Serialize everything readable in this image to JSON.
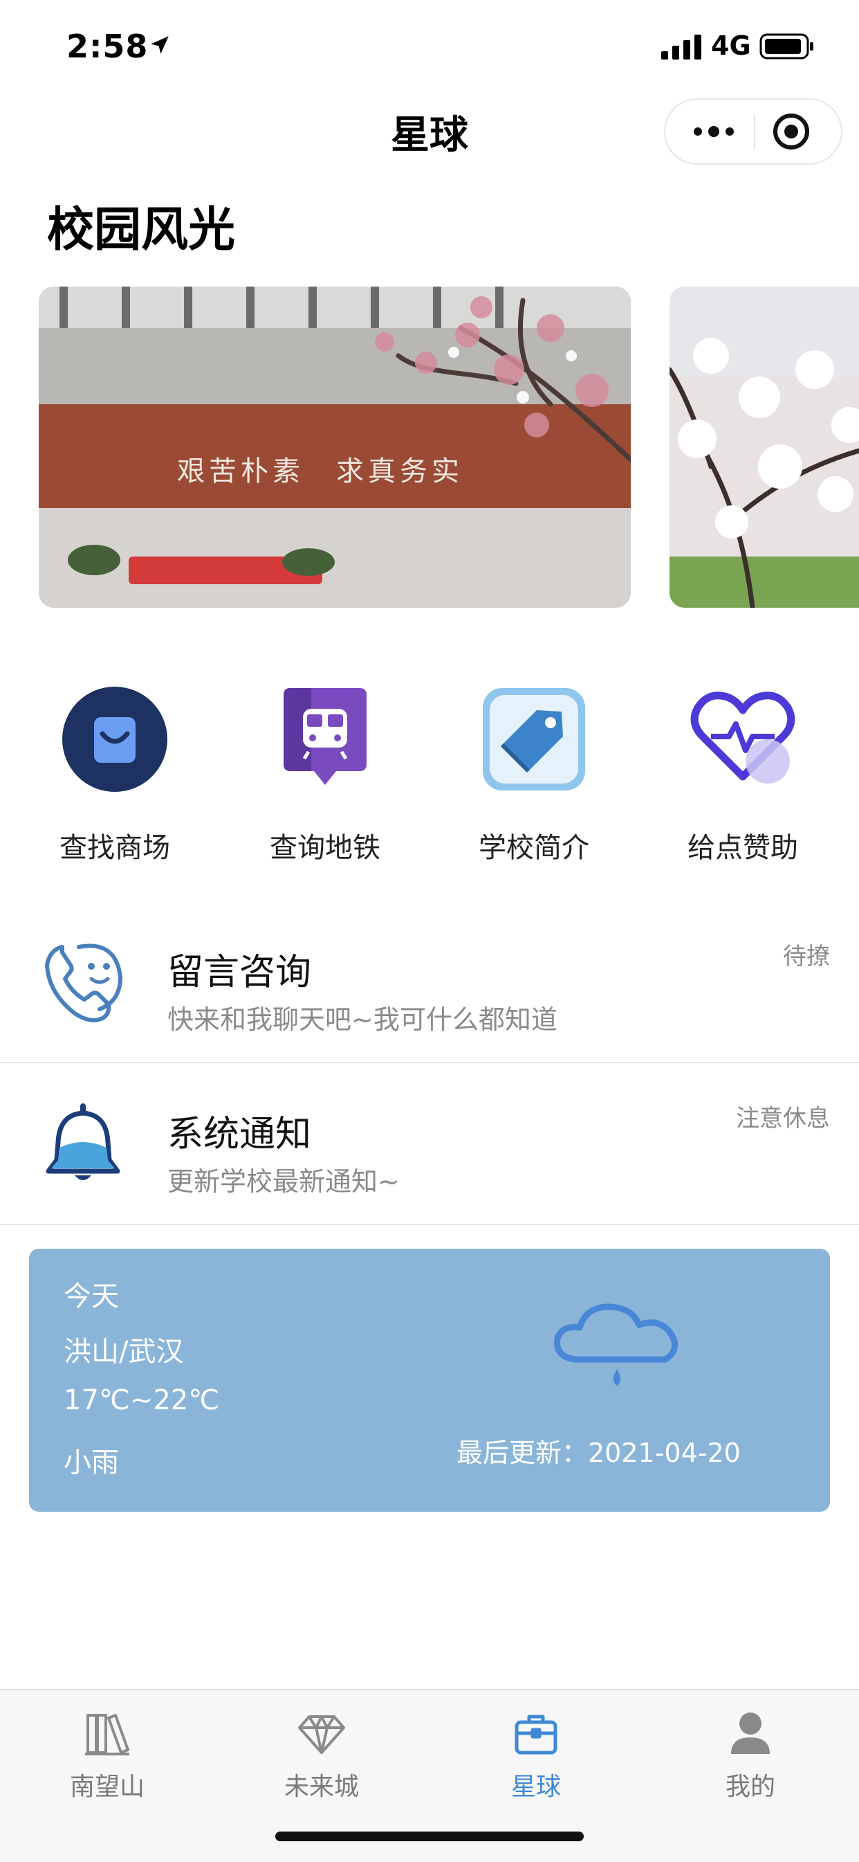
{
  "status_bar": {
    "time": "2:58",
    "network": "4G"
  },
  "header": {
    "title": "星球"
  },
  "section": {
    "title": "校园风光"
  },
  "banner": {
    "slogan": "艰苦朴素　求真务实"
  },
  "grid": [
    {
      "label": "查找商场",
      "icon": "shopping-bag-icon"
    },
    {
      "label": "查询地铁",
      "icon": "subway-icon"
    },
    {
      "label": "学校简介",
      "icon": "tag-icon"
    },
    {
      "label": "给点赞助",
      "icon": "heart-pulse-icon"
    }
  ],
  "messages": [
    {
      "title": "留言咨询",
      "subtitle": "快来和我聊天吧~我可什么都知道",
      "meta": "待撩",
      "icon": "phone-smile-icon"
    },
    {
      "title": "系统通知",
      "subtitle": "更新学校最新通知~",
      "meta": "注意休息",
      "icon": "bell-icon"
    }
  ],
  "weather": {
    "day": "今天",
    "location": "洪山/武汉",
    "temperature": "17℃~22℃",
    "condition": "小雨",
    "updated": "最后更新：2021-04-20"
  },
  "tabbar": [
    {
      "label": "南望山",
      "icon": "books-icon",
      "active": false
    },
    {
      "label": "未来城",
      "icon": "diamond-icon",
      "active": false
    },
    {
      "label": "星球",
      "icon": "briefcase-icon",
      "active": true
    },
    {
      "label": "我的",
      "icon": "user-icon",
      "active": false
    }
  ],
  "colors": {
    "accent": "#3f88d6",
    "weather_card": "#8ab5d8",
    "muted_text": "#8a8a8a"
  }
}
